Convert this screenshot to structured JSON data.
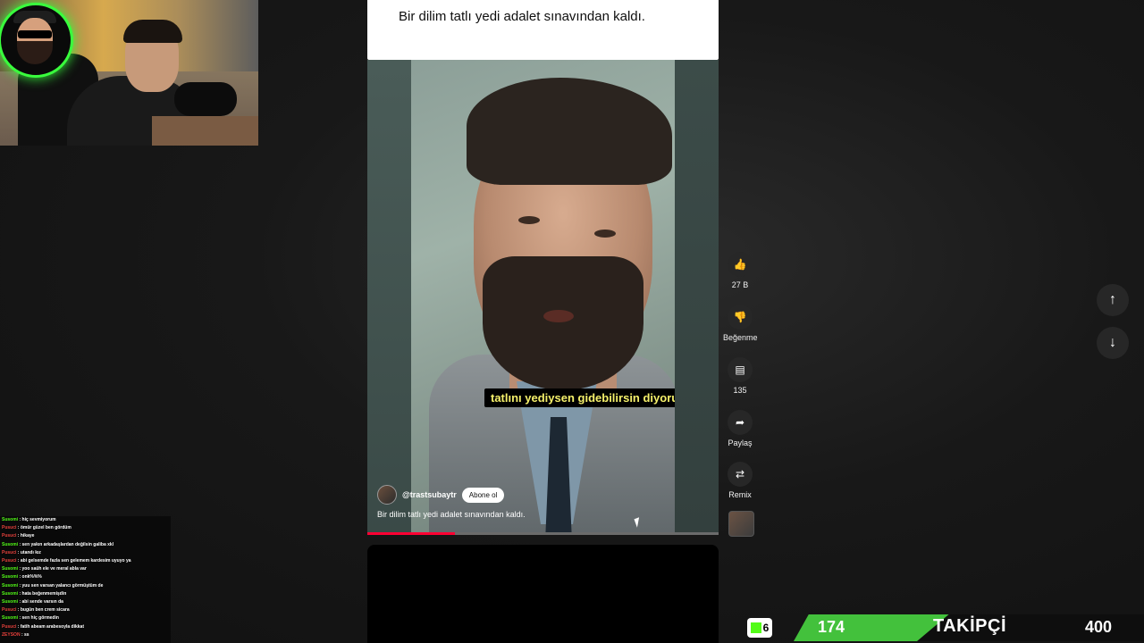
{
  "top_card": {
    "caption": "Bir dilim tatlı yedi adalet sınavından kaldı."
  },
  "video": {
    "subtitle": "tatlını yediysen gidebilirsin diyorum",
    "channel_handle": "@trastsubaytr",
    "subscribe_label": "Abone ol",
    "caption": "Bir dilim tatlı yedi adalet sınavından kaldı.",
    "progress_fraction": 0.25
  },
  "actions": [
    {
      "name": "like",
      "icon": "thumbs-up-icon",
      "label": "27 B"
    },
    {
      "name": "dislike",
      "icon": "thumbs-down-icon",
      "label": "Beğenme"
    },
    {
      "name": "comments",
      "icon": "comment-icon",
      "label": "135"
    },
    {
      "name": "share",
      "icon": "share-icon",
      "label": "Paylaş"
    },
    {
      "name": "remix",
      "icon": "remix-icon",
      "label": "Remix"
    }
  ],
  "chat": [
    {
      "user": "Susomi",
      "color": "#53fc18",
      "text": "hiç sevmiyorum"
    },
    {
      "user": "Pusuci",
      "color": "#e8413c",
      "text": "ömür güzel ben gördüm"
    },
    {
      "user": "Pusuci",
      "color": "#e8413c",
      "text": "hikaye"
    },
    {
      "user": "Susomi",
      "color": "#53fc18",
      "text": "sen yakın arkadaşlardan değilsin galiba xkl"
    },
    {
      "user": "Pusuci",
      "color": "#e8413c",
      "text": "utandı kız"
    },
    {
      "user": "Pusuci",
      "color": "#e8413c",
      "text": "abi gelsemde fazla sen gelemem kardesim uyuyo ya"
    },
    {
      "user": "Susomi",
      "color": "#53fc18",
      "text": "yoo saüh ele ve meral abla var"
    },
    {
      "user": "Susomi",
      "color": "#53fc18",
      "text": "onk%%%"
    },
    {
      "user": "Susomi",
      "color": "#53fc18",
      "text": "yuu sen varsan yalancı görmüştüm de"
    },
    {
      "user": "Susomi",
      "color": "#53fc18",
      "text": "hata beğenmemişdin"
    },
    {
      "user": "Susomi",
      "color": "#53fc18",
      "text": "abi sende varsın da"
    },
    {
      "user": "Pusuci",
      "color": "#e8413c",
      "text": "bugün ben crem sicara"
    },
    {
      "user": "Susomi",
      "color": "#53fc18",
      "text": "sen hiç görmedin"
    },
    {
      "user": "Pusuci",
      "color": "#e8413c",
      "text": "fatih abeam arabesoyla dikkat"
    },
    {
      "user": "ZEYSON",
      "color": "#e8413c",
      "text": "ss"
    }
  ],
  "follower_bar": {
    "kick_count": "6",
    "current": "174",
    "label": "TAKİPÇİ",
    "goal": "400",
    "accent": "#43c13c"
  }
}
